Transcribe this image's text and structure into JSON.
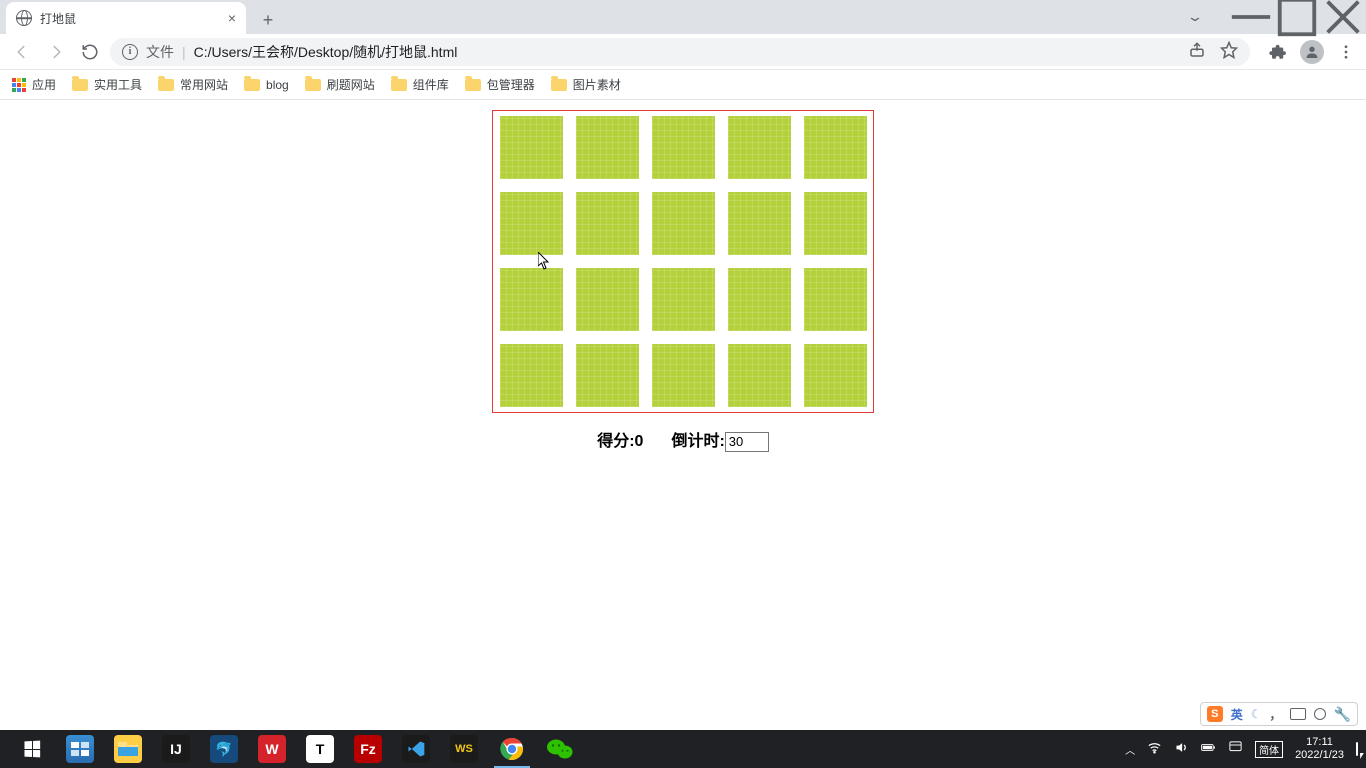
{
  "tab": {
    "title": "打地鼠"
  },
  "address": {
    "file_label": "文件",
    "path": "C:/Users/王会称/Desktop/随机/打地鼠.html"
  },
  "bookmarks": {
    "apps_label": "应用",
    "items": [
      "实用工具",
      "常用网站",
      "blog",
      "刷题网站",
      "组件库",
      "包管理器",
      "图片素材"
    ]
  },
  "game": {
    "rows": 4,
    "cols": 5,
    "score_label": "得分:",
    "score_value": "0",
    "countdown_label": "倒计时:",
    "countdown_value": "30",
    "cell_color": "#b4d03b"
  },
  "sogou": {
    "lang": "英",
    "ime": "简体"
  },
  "clock": {
    "time": "17:11",
    "date": "2022/1/23"
  }
}
